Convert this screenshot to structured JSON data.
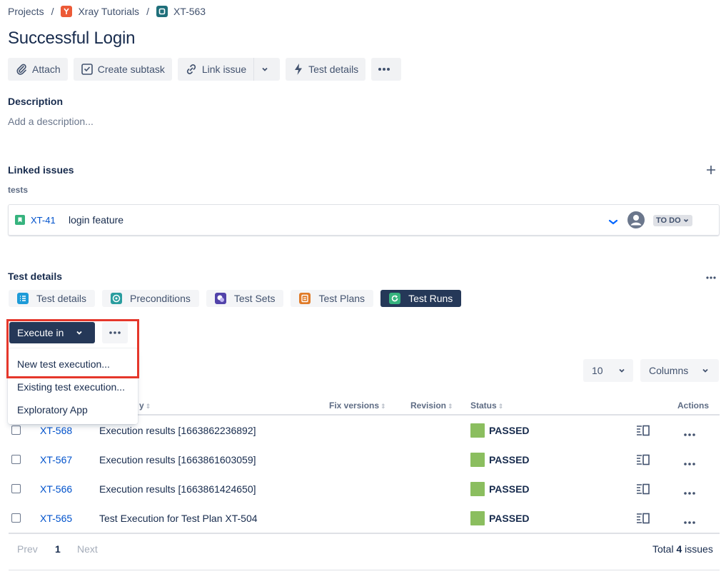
{
  "breadcrumb": {
    "projects": "Projects",
    "project": "Xray Tutorials",
    "issue": "XT-563",
    "separator": "/"
  },
  "issue": {
    "title": "Successful Login"
  },
  "toolbar": {
    "attach": "Attach",
    "create_subtask": "Create subtask",
    "link_issue": "Link issue",
    "test_details": "Test details"
  },
  "description": {
    "heading": "Description",
    "placeholder": "Add a description..."
  },
  "linked_issues": {
    "heading": "Linked issues",
    "relation": "tests",
    "item": {
      "key": "XT-41",
      "summary": "login feature",
      "status": "TO DO"
    }
  },
  "test_details": {
    "heading": "Test details",
    "tabs": [
      {
        "label": "Test details",
        "color": "#1d9bd8"
      },
      {
        "label": "Preconditions",
        "color": "#2a9d9f"
      },
      {
        "label": "Test Sets",
        "color": "#5243aa"
      },
      {
        "label": "Test Plans",
        "color": "#e07b29"
      },
      {
        "label": "Test Runs",
        "color": "#36b37e"
      }
    ]
  },
  "execute": {
    "button": "Execute in",
    "menu": [
      "New test execution...",
      "Existing test execution...",
      "Exploratory App"
    ]
  },
  "controls": {
    "page_size": "10",
    "columns": "Columns"
  },
  "table": {
    "headers": {
      "summary_partial": "y",
      "fix_versions": "Fix versions",
      "revision": "Revision",
      "status": "Status",
      "actions": "Actions"
    },
    "rows": [
      {
        "key": "XT-568",
        "summary": "Execution results [1663862236892]",
        "status": "PASSED"
      },
      {
        "key": "XT-567",
        "summary": "Execution results [1663861603059]",
        "status": "PASSED"
      },
      {
        "key": "XT-566",
        "summary": "Execution results [1663861424650]",
        "status": "PASSED"
      },
      {
        "key": "XT-565",
        "summary": "Test Execution for Test Plan XT-504",
        "status": "PASSED"
      }
    ]
  },
  "pagination": {
    "prev": "Prev",
    "page": "1",
    "next": "Next",
    "total_prefix": "Total",
    "total_count": "4",
    "total_suffix": "issues"
  },
  "colors": {
    "accent_dark": "#253858",
    "passed": "#8bbe5f",
    "link": "#0052cc",
    "highlight": "#e5372b"
  }
}
